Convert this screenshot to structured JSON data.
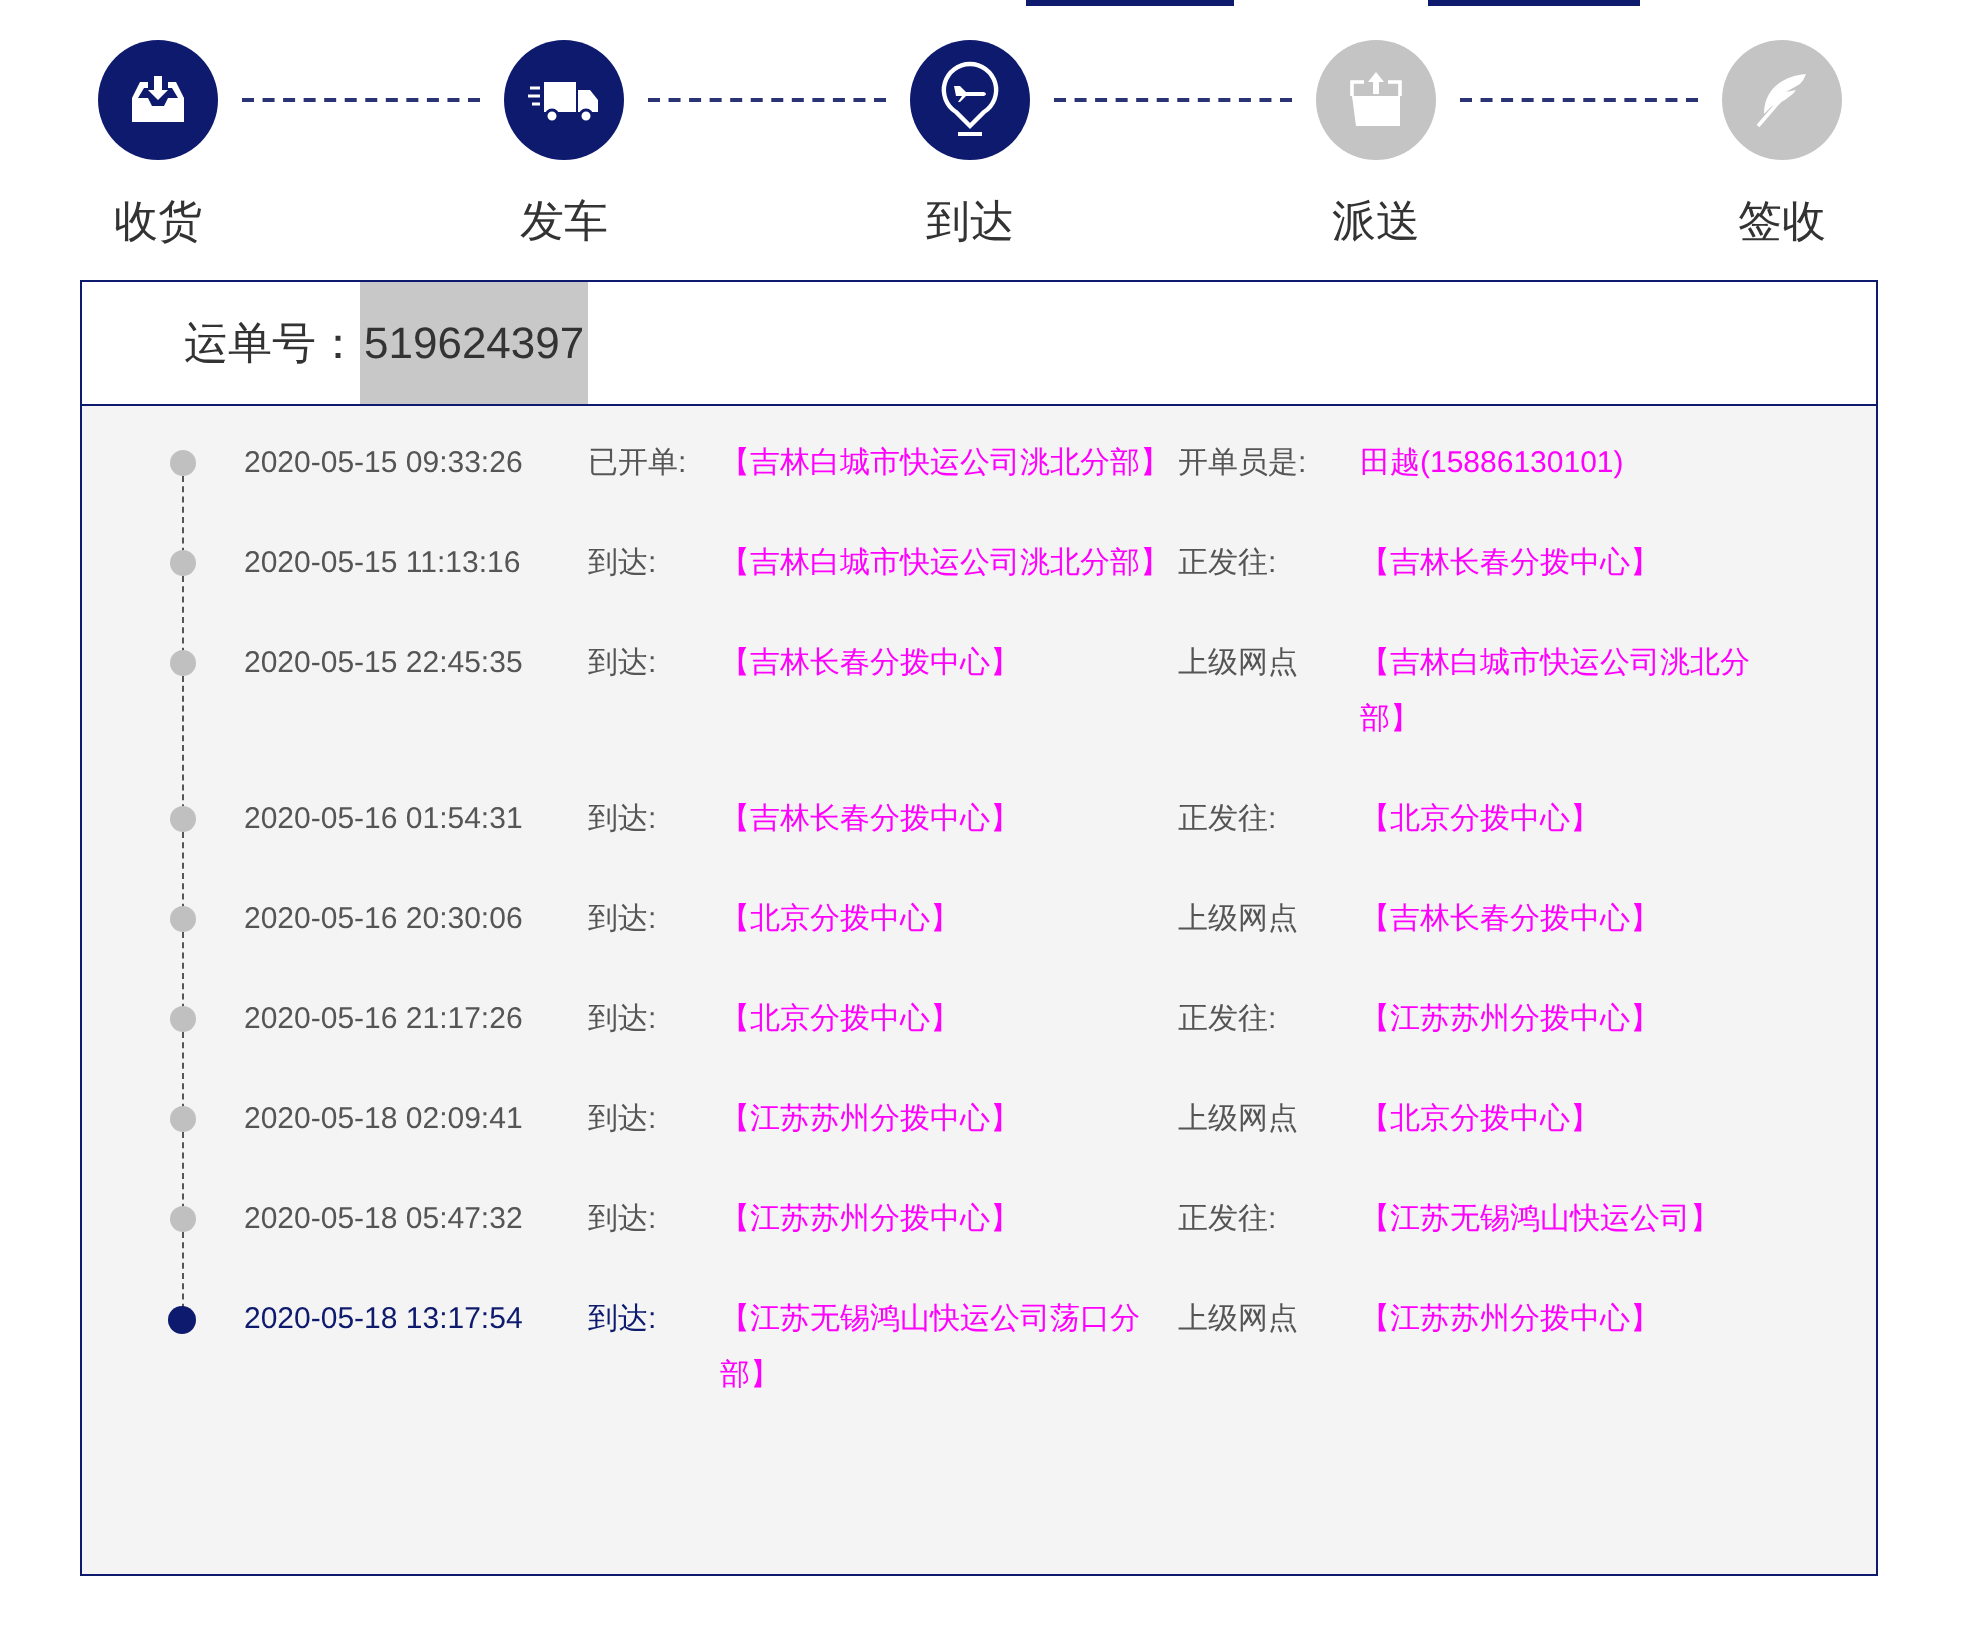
{
  "steps": [
    {
      "label": "收货",
      "kind": "inbox",
      "done": true
    },
    {
      "label": "发车",
      "kind": "truck",
      "done": true
    },
    {
      "label": "到达",
      "kind": "plane",
      "done": true
    },
    {
      "label": "派送",
      "kind": "upload",
      "done": false
    },
    {
      "label": "签收",
      "kind": "feather",
      "done": false
    }
  ],
  "waybill": {
    "label": "运单号：",
    "number": "519624397"
  },
  "events": [
    {
      "time": "2020-05-15 09:33:26",
      "action": "已开单:",
      "place": "【吉林白城市快运公司洮北分部】",
      "label_2": "开单员是:",
      "value_2": "田越(15886130101)",
      "current": false
    },
    {
      "time": "2020-05-15 11:13:16",
      "action": "到达:",
      "place": "【吉林白城市快运公司洮北分部】",
      "label_2": "正发往:",
      "value_2": "【吉林长春分拨中心】",
      "current": false
    },
    {
      "time": "2020-05-15 22:45:35",
      "action": "到达:",
      "place": "【吉林长春分拨中心】",
      "label_2": "上级网点",
      "value_2": "【吉林白城市快运公司洮北分部】",
      "current": false
    },
    {
      "time": "2020-05-16 01:54:31",
      "action": "到达:",
      "place": "【吉林长春分拨中心】",
      "label_2": "正发往:",
      "value_2": "【北京分拨中心】",
      "current": false
    },
    {
      "time": "2020-05-16 20:30:06",
      "action": "到达:",
      "place": "【北京分拨中心】",
      "label_2": "上级网点",
      "value_2": "【吉林长春分拨中心】",
      "current": false
    },
    {
      "time": "2020-05-16 21:17:26",
      "action": "到达:",
      "place": "【北京分拨中心】",
      "label_2": "正发往:",
      "value_2": "【江苏苏州分拨中心】",
      "current": false
    },
    {
      "time": "2020-05-18 02:09:41",
      "action": "到达:",
      "place": "【江苏苏州分拨中心】",
      "label_2": "上级网点",
      "value_2": "【北京分拨中心】",
      "current": false
    },
    {
      "time": "2020-05-18 05:47:32",
      "action": "到达:",
      "place": "【江苏苏州分拨中心】",
      "label_2": "正发往:",
      "value_2": "【江苏无锡鸿山快运公司】",
      "current": false
    },
    {
      "time": "2020-05-18 13:17:54",
      "action": "到达:",
      "place": "【江苏无锡鸿山快运公司荡口分部】",
      "label_2": "上级网点",
      "value_2": "【江苏苏州分拨中心】",
      "current": true
    }
  ]
}
